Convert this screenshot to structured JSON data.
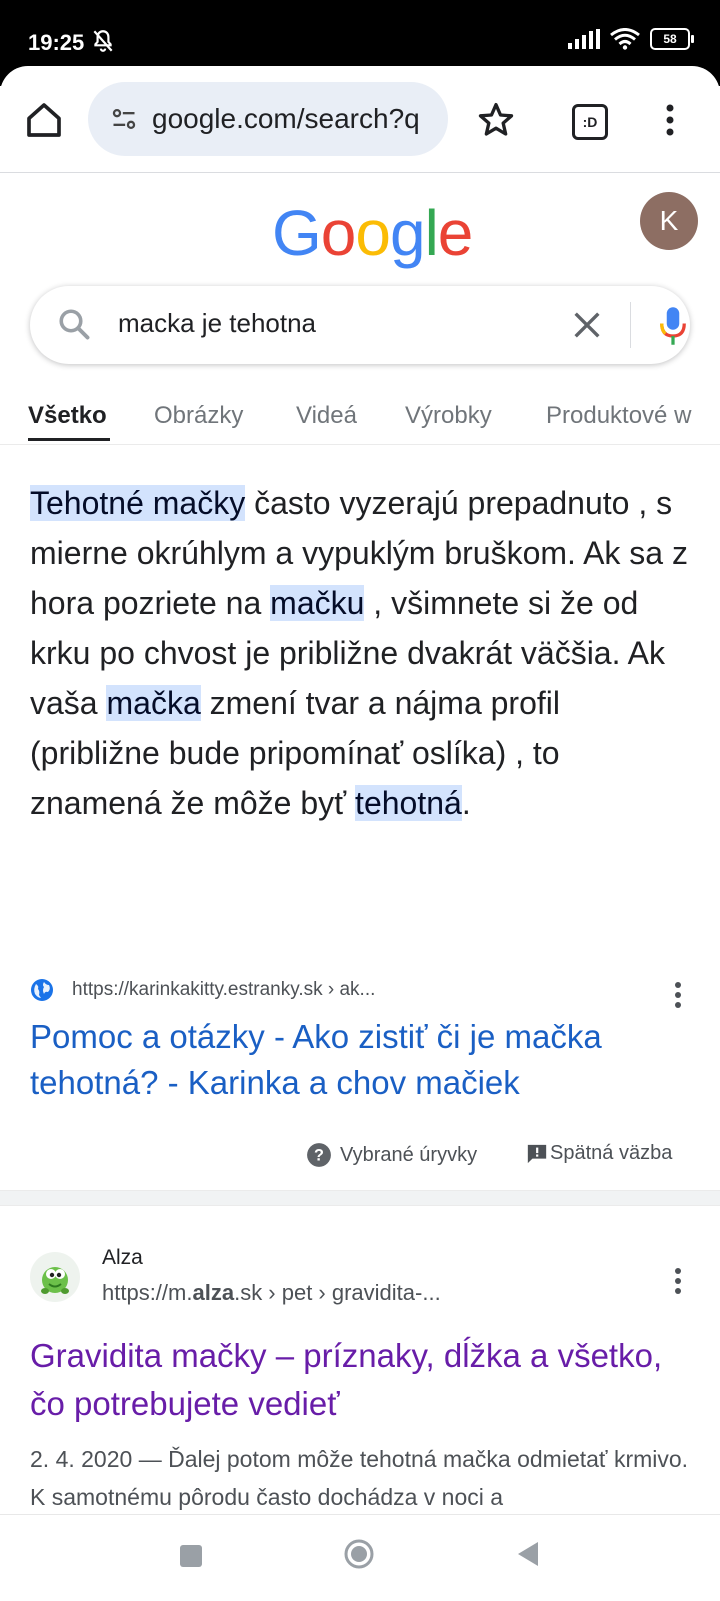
{
  "status": {
    "time": "19:25",
    "battery": "58",
    "icons": [
      "bell-off-icon",
      "signal-icon",
      "wifi-icon",
      "battery-icon"
    ]
  },
  "browser": {
    "url": "google.com/search?q",
    "tabs_label": ":D",
    "icons": [
      "home-icon",
      "tune-icon",
      "star-icon",
      "tabs-icon",
      "overflow-menu-icon"
    ]
  },
  "google": {
    "logo": "Google",
    "logo_colors": [
      "#4285F4",
      "#EA4335",
      "#FBBC05",
      "#4285F4",
      "#34A853",
      "#EA4335"
    ],
    "avatar_letter": "K",
    "query": "macka je tehotna"
  },
  "tabs": [
    {
      "label": "Všetko",
      "active": true
    },
    {
      "label": "Obrázky"
    },
    {
      "label": "Videá"
    },
    {
      "label": "Výrobky"
    },
    {
      "label": "Produktové w"
    }
  ],
  "featured_snippet": {
    "parts": [
      {
        "t": "Tehotné mačky",
        "hl": true
      },
      {
        "t": " často vyzerajú prepadnuto , s mierne okrúhlym a vypuklým bruškom. Ak sa z hora pozriete na "
      },
      {
        "t": "mačku",
        "hl": true
      },
      {
        "t": " , všimnete si že od krku po chvost je približne dvakrát väčšia. Ak vaša "
      },
      {
        "t": "mačka",
        "hl": true
      },
      {
        "t": " zmení tvar a nájma profil (približne bude pripomínať oslíka) , to znamená že môže byť "
      },
      {
        "t": "tehotná",
        "hl": true
      },
      {
        "t": "."
      }
    ],
    "source_url": "https://karinkakitty.estranky.sk › ak...",
    "link_title": "Pomoc a otázky - Ako zistiť či je mačka tehotná? - Karinka a chov mačiek",
    "footer_snippets": "Vybrané úryvky",
    "footer_feedback": "Spätná väzba"
  },
  "result2": {
    "site_name": "Alza",
    "url_prefix": "https://m.",
    "url_bold": "alza",
    "url_suffix": ".sk › pet › gravidita-...",
    "title": "Gravidita mačky – príznaky, dĺžka a všetko, čo potrebujete vedieť",
    "description": "2. 4. 2020 — Ďalej potom môže tehotná mačka odmietať krmivo. K samotnému pôrodu často dochádza v noci a"
  },
  "colors": {
    "highlight": "#d3e3fd",
    "link_blue": "#1a5fc4",
    "visited_purple": "#681da8"
  }
}
